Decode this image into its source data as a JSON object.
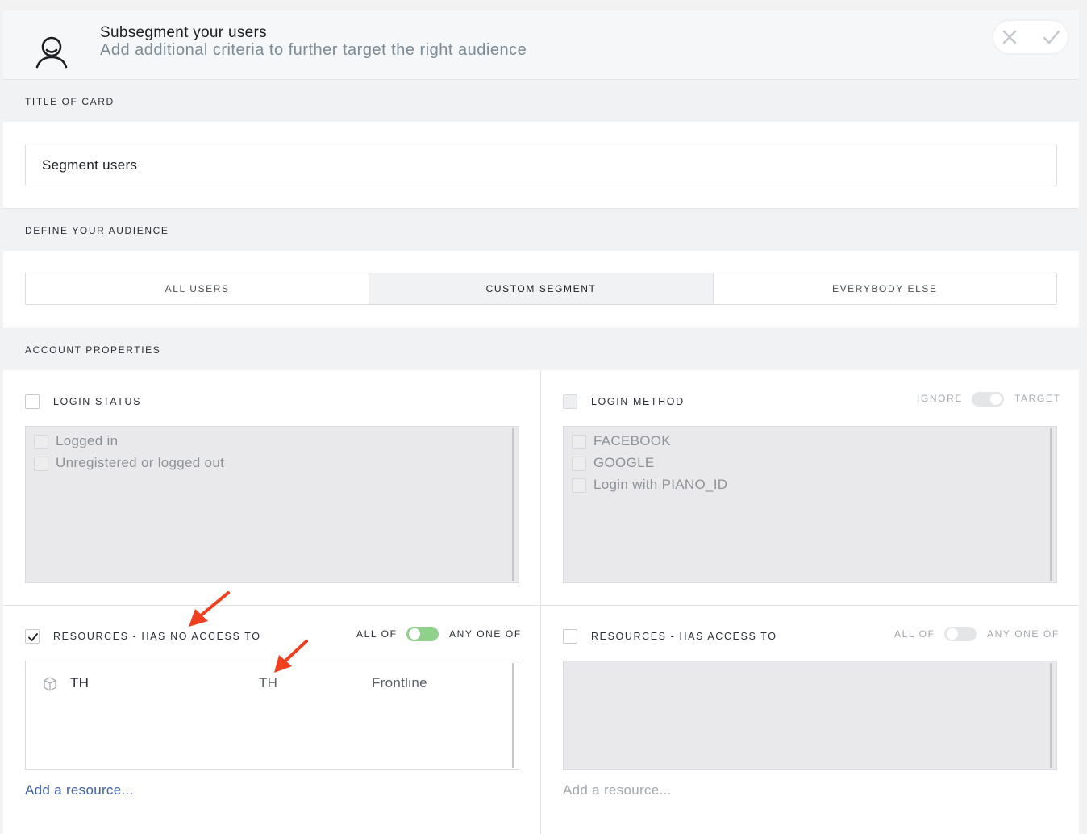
{
  "header": {
    "title": "Subsegment your users",
    "subtitle": "Add additional criteria to further target the right audience"
  },
  "title_section": {
    "label": "TITLE OF CARD",
    "value": "Segment users"
  },
  "audience_section": {
    "label": "DEFINE YOUR AUDIENCE",
    "options": [
      "ALL USERS",
      "CUSTOM SEGMENT",
      "EVERYBODY ELSE"
    ],
    "selected": "CUSTOM SEGMENT"
  },
  "account_section": {
    "label": "ACCOUNT PROPERTIES",
    "login_status": {
      "label": "LOGIN STATUS",
      "checked": false,
      "options": [
        "Logged in",
        "Unregistered or logged out"
      ]
    },
    "login_method": {
      "label": "LOGIN METHOD",
      "checked": false,
      "toggle_left": "IGNORE",
      "toggle_right": "TARGET",
      "options": [
        "FACEBOOK",
        "GOOGLE",
        "Login with PIANO_ID"
      ]
    },
    "resources_no_access": {
      "label": "RESOURCES - HAS NO ACCESS TO",
      "checked": true,
      "toggle_left": "ALL OF",
      "toggle_right": "ANY ONE OF",
      "toggle_on": true,
      "rows": [
        {
          "name": "TH",
          "id": "TH",
          "type": "Frontline"
        }
      ],
      "add_link": "Add a resource..."
    },
    "resources_access": {
      "label": "RESOURCES - HAS ACCESS TO",
      "checked": false,
      "toggle_left": "ALL OF",
      "toggle_right": "ANY ONE OF",
      "toggle_on": false,
      "rows": [],
      "add_link": "Add a resource..."
    }
  },
  "colors": {
    "accent_link": "#3f62a7",
    "toggle_on": "#8fd18a",
    "annotation_arrow": "#f0401f"
  },
  "icons": [
    "user-segment-icon",
    "close-icon",
    "check-icon",
    "checkbox-check-icon",
    "resource-box-icon",
    "annotation-arrow-icon"
  ]
}
